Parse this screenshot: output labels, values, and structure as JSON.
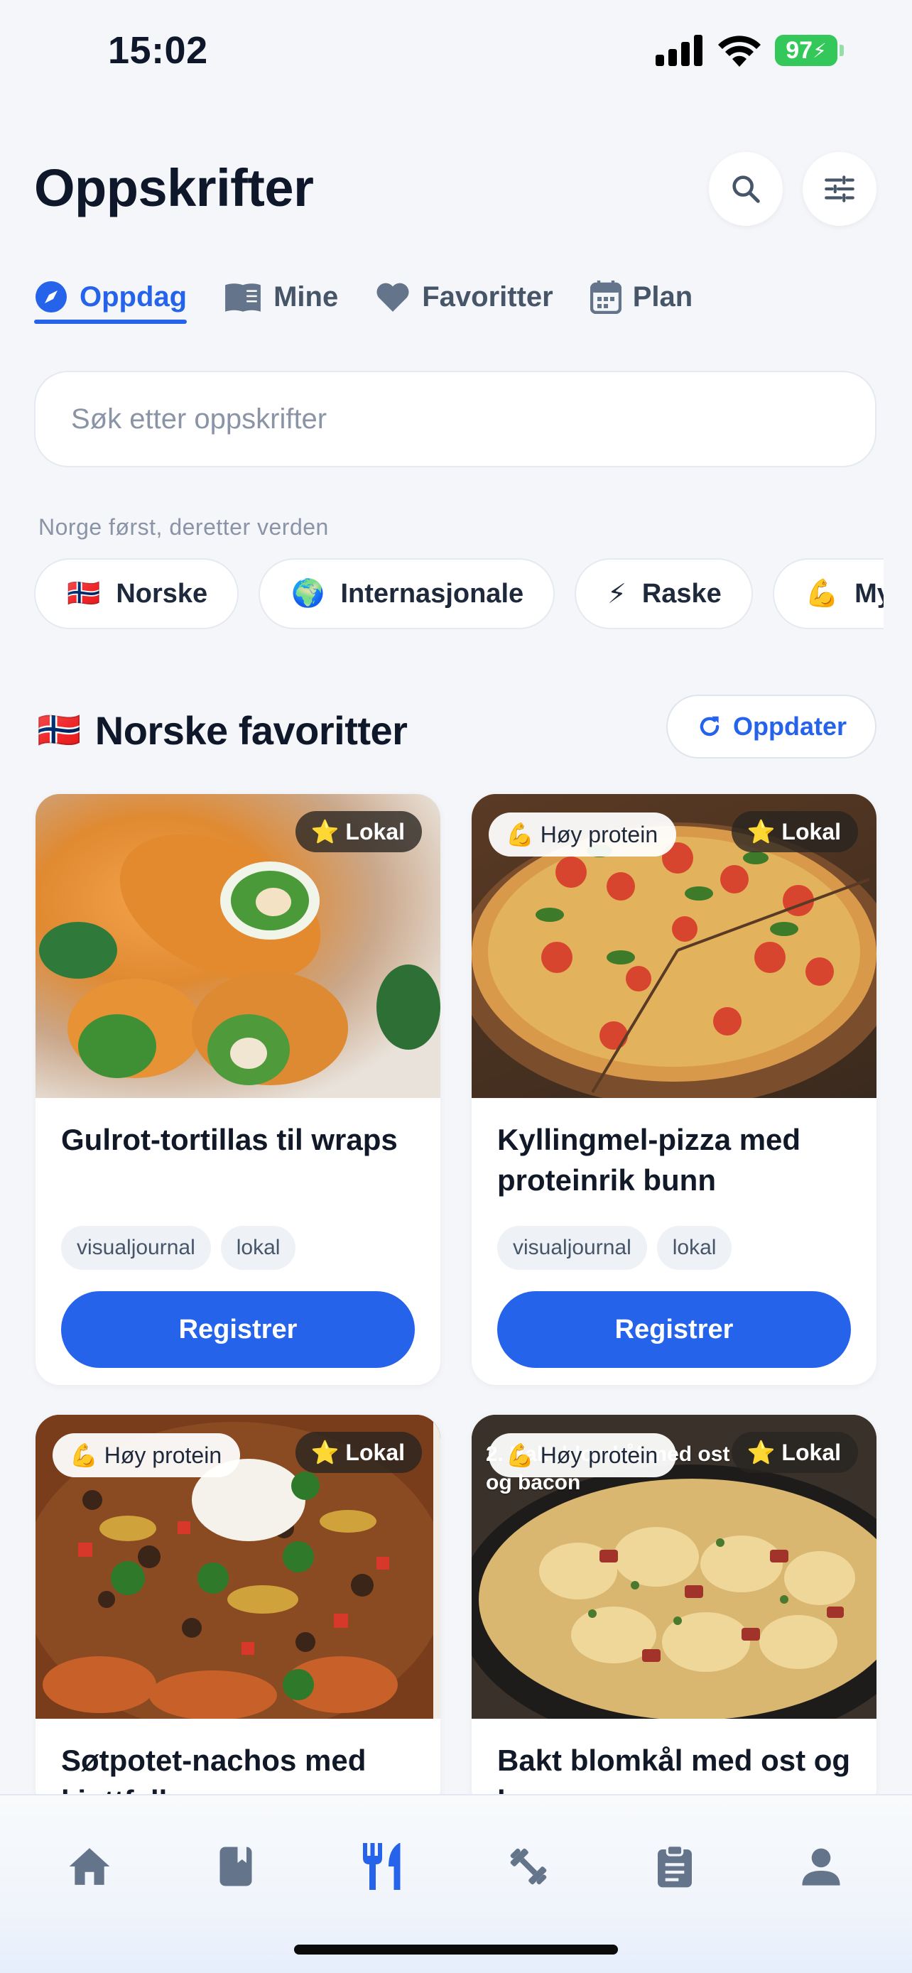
{
  "status_bar": {
    "time": "15:02",
    "battery": "97"
  },
  "header": {
    "title": "Oppskrifter"
  },
  "tabs": [
    {
      "label": "Oppdag",
      "icon": "compass-icon",
      "active": true
    },
    {
      "label": "Mine",
      "icon": "book-icon",
      "active": false
    },
    {
      "label": "Favoritter",
      "icon": "heart-icon",
      "active": false
    },
    {
      "label": "Plan",
      "icon": "calendar-icon",
      "active": false
    }
  ],
  "search": {
    "placeholder": "Søk etter oppskrifter"
  },
  "section_hint": "Norge først, deretter verden",
  "chips": [
    {
      "emoji": "🇳🇴",
      "label": "Norske"
    },
    {
      "emoji": "🌍",
      "label": "Internasjonale"
    },
    {
      "emoji": "⚡",
      "label": "Raske"
    },
    {
      "emoji": "💪",
      "label": "Mye protein"
    }
  ],
  "section": {
    "flag": "🇳🇴",
    "title": "Norske favoritter",
    "refresh_label": "Oppdater"
  },
  "recipes": [
    {
      "title": "Gulrot-tortillas til wraps",
      "tags": [
        "visualjournal",
        "lokal"
      ],
      "button": "Registrer",
      "local_badge": "⭐ Lokal",
      "protein_badge": ""
    },
    {
      "title": "Kyllingmel-pizza med proteinrik bunn",
      "tags": [
        "visualjournal",
        "lokal"
      ],
      "button": "Registrer",
      "local_badge": "⭐ Lokal",
      "protein_badge": "💪 Høy protein"
    },
    {
      "title": "Søtpotet-nachos med kjøttfyll",
      "tags": [],
      "button": "",
      "local_badge": "⭐ Lokal",
      "protein_badge": "💪 Høy protein"
    },
    {
      "title": "Bakt blomkål med ost og bacon",
      "tags": [],
      "button": "",
      "local_badge": "⭐ Lokal",
      "protein_badge": "💪 Høy protein",
      "image_caption": "2. Bakt blomkål med ost og bacon"
    }
  ],
  "bottom_nav": [
    {
      "icon": "home-icon",
      "active": false
    },
    {
      "icon": "book-icon",
      "active": false
    },
    {
      "icon": "fork-knife-icon",
      "active": true
    },
    {
      "icon": "dumbbell-icon",
      "active": false
    },
    {
      "icon": "clipboard-icon",
      "active": false
    },
    {
      "icon": "user-icon",
      "active": false
    }
  ],
  "colors": {
    "accent": "#2563eb",
    "background": "#f4f6f9",
    "text": "#0f172a",
    "muted": "#8a94a6"
  }
}
